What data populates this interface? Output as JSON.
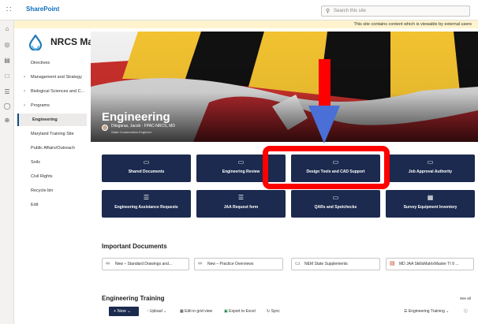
{
  "suite": {
    "app_name": "SharePoint",
    "search_placeholder": "Search this site"
  },
  "notice": {
    "text": "This site contains content which is viewable by external users"
  },
  "site": {
    "title": "NRCS Maryland"
  },
  "nav": {
    "items": [
      {
        "label": "Directives",
        "chevron": false,
        "active": false
      },
      {
        "label": "Management and Strategy",
        "chevron": true,
        "active": false
      },
      {
        "label": "Biological Sciences and C...",
        "chevron": true,
        "active": false
      },
      {
        "label": "Programs",
        "chevron": true,
        "active": false
      },
      {
        "label": "Engineering",
        "chevron": false,
        "active": true
      },
      {
        "label": "Maryland Training Site",
        "chevron": false,
        "active": false
      },
      {
        "label": "Public Affairs/Outreach",
        "chevron": false,
        "active": false
      },
      {
        "label": "Soils",
        "chevron": false,
        "active": false
      },
      {
        "label": "Civil Rights",
        "chevron": false,
        "active": false
      },
      {
        "label": "Recycle bin",
        "chevron": false,
        "active": false
      },
      {
        "label": "Edit",
        "chevron": false,
        "active": false
      }
    ]
  },
  "hero": {
    "title": "Engineering",
    "person": "Ditsgaras, Jacob - FPAC-NRCS, MD",
    "role": "State Conservation Engineer"
  },
  "quick_links": {
    "tiles": [
      {
        "label": "Shared Documents",
        "icon": "folder-icon"
      },
      {
        "label": "Engineering Review",
        "icon": "folder-icon"
      },
      {
        "label": "Design Tools and CAD Support",
        "icon": "folder-icon"
      },
      {
        "label": "Job Approval Authority",
        "icon": "folder-icon"
      },
      {
        "label": "Engineering Assistance Requests",
        "icon": "list-icon"
      },
      {
        "label": "JAA Request form",
        "icon": "list-icon"
      },
      {
        "label": "QARs and Spotchecks",
        "icon": "folder-icon"
      },
      {
        "label": "Survey Equipment Inventory",
        "icon": "calculator-icon"
      }
    ]
  },
  "important_docs": {
    "title": "Important Documents",
    "items": [
      {
        "label": "New – Standard Drawings and...",
        "icon": "link-icon"
      },
      {
        "label": "New – Practice Overviews",
        "icon": "link-icon"
      },
      {
        "label": "NEM State Supplements",
        "icon": "folder-icon"
      },
      {
        "label": "MD JAA SkillsMatrixMaster TI 9 ...",
        "icon": "pdf-icon"
      }
    ]
  },
  "training": {
    "title": "Engineering Training",
    "see_all": "See all",
    "commands": {
      "new": "New",
      "upload": "Upload",
      "edit_grid": "Edit in grid view",
      "export": "Export to Excel",
      "sync": "Sync",
      "view": "Engineering Training"
    }
  },
  "colors": {
    "tile_bg": "#1b2a4e",
    "annotation_red": "#ff0000",
    "arrow_blue": "#4a6fd6",
    "notice_bg": "#fff4ce"
  }
}
